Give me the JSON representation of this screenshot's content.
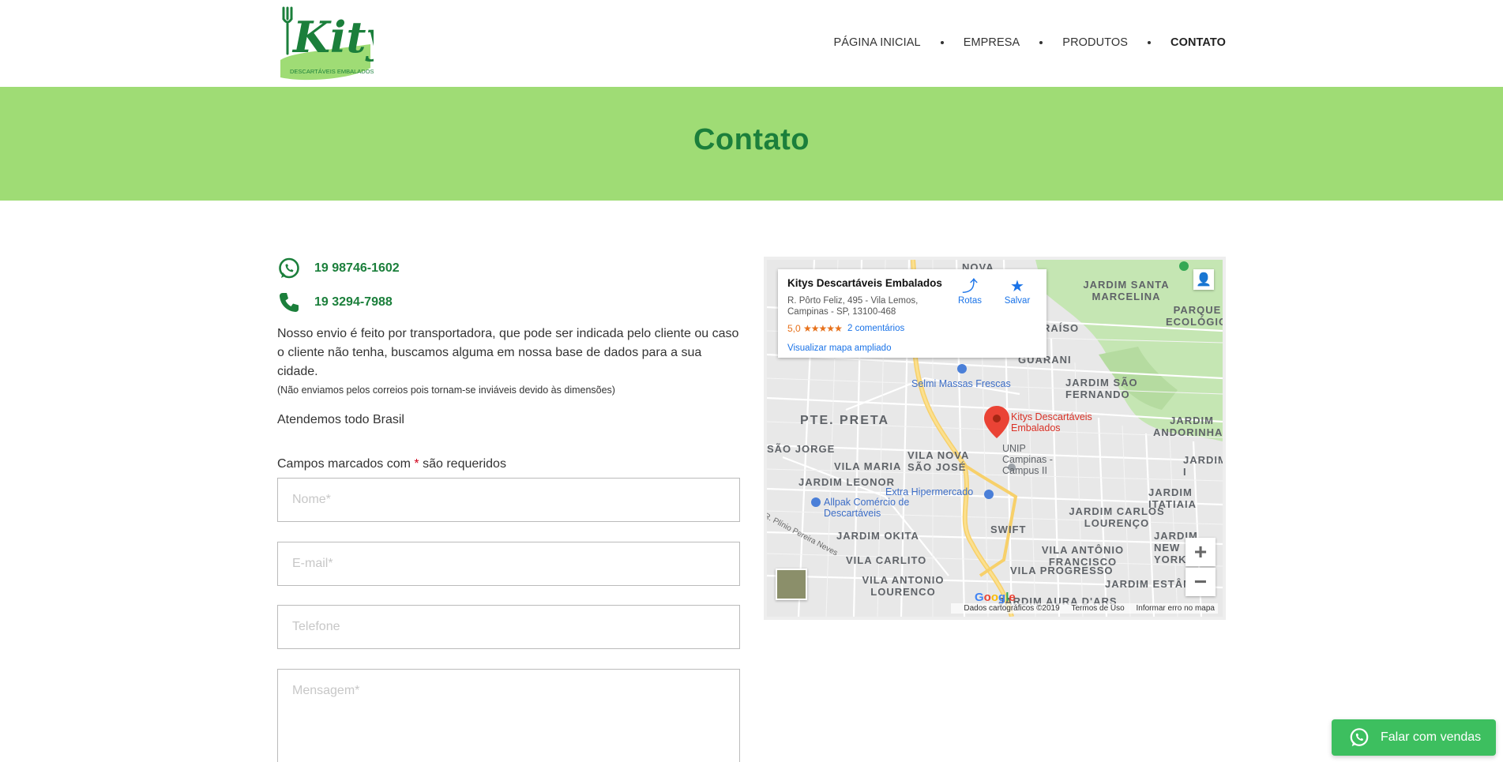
{
  "header": {
    "logo_text": "Kitys",
    "logo_subtext": "DESCARTÁVEIS EMBALADOS",
    "nav": [
      {
        "label": "PÁGINA INICIAL",
        "active": false
      },
      {
        "label": "EMPRESA",
        "active": false
      },
      {
        "label": "PRODUTOS",
        "active": false
      },
      {
        "label": "CONTATO",
        "active": true
      }
    ]
  },
  "banner": {
    "title": "Contato"
  },
  "contact": {
    "whatsapp_number": "19 98746-1602",
    "phone_number": "19 3294-7988",
    "shipping_text": "Nosso envio é feito por transportadora, que pode ser indicada pelo cliente ou caso o cliente não tenha, buscamos alguma em nossa base de dados para a sua cidade.",
    "shipping_note": "(Não enviamos pelos correios pois tornam-se inviáveis devido às dimensões)",
    "coverage": "Atendemos todo Brasil"
  },
  "form": {
    "required_prefix": "Campos marcados com",
    "required_star": "*",
    "required_suffix": "são requeridos",
    "name_placeholder": "Nome*",
    "email_placeholder": "E-mail*",
    "phone_placeholder": "Telefone",
    "message_placeholder": "Mensagem*"
  },
  "map": {
    "place_name": "Kitys Descartáveis Embalados",
    "address": "R. Pôrto Feliz, 495 - Vila Lemos, Campinas - SP, 13100-468",
    "rating": "5,0",
    "stars": "★★★★★",
    "reviews": "2 comentários",
    "view_larger": "Visualizar mapa ampliado",
    "directions_label": "Rotas",
    "save_label": "Salvar",
    "zoom_in": "+",
    "zoom_out": "−",
    "footer_data": "Dados cartográficos ©2019",
    "footer_terms": "Termos de Uso",
    "footer_report": "Informar erro no mapa",
    "google": "Google",
    "marker_label": "Kitys Descartáveis Embalados",
    "area_labels": [
      "NOVA",
      "JARDIM SANTA MARCELINA",
      "PARQUE ECOLÓGICO",
      "RAÍSO",
      "GUARANI",
      "JARDIM SÃO FERNANDO",
      "PTE. PRETA",
      "JARDIM ANDORINHAS",
      "SÃO JORGE",
      "VILA NOVA SÃO JOSÉ",
      "VILA MARIA",
      "JARDIM I",
      "JARDIM LEONOR",
      "JARDIM ITATIAIA",
      "JARDIM CARLOS LOURENÇO",
      "JARDIM OKITA",
      "SWIFT",
      "JARDIM NEW YORK",
      "VILA CARLITO",
      "VILA ANTÔNIO FRANCISCO",
      "VILA PROGRESSO",
      "VILA ANTONIO LOURENCO",
      "JARDIM ESTÂNCIA",
      "JARDIM AURA D'ARS"
    ],
    "pois": [
      "Selmi Massas Frescas",
      "UNIP Campinas - Campus II",
      "Extra Hipermercado",
      "Allpak Comércio de Descartáveis"
    ],
    "street": "R. Plínio Pereira Neves"
  },
  "whatsapp_button": {
    "label": "Falar com vendas"
  },
  "colors": {
    "brand_green": "#1b7f3b",
    "banner_green": "#9fdc75",
    "whatsapp_green": "#3dbf5f"
  }
}
